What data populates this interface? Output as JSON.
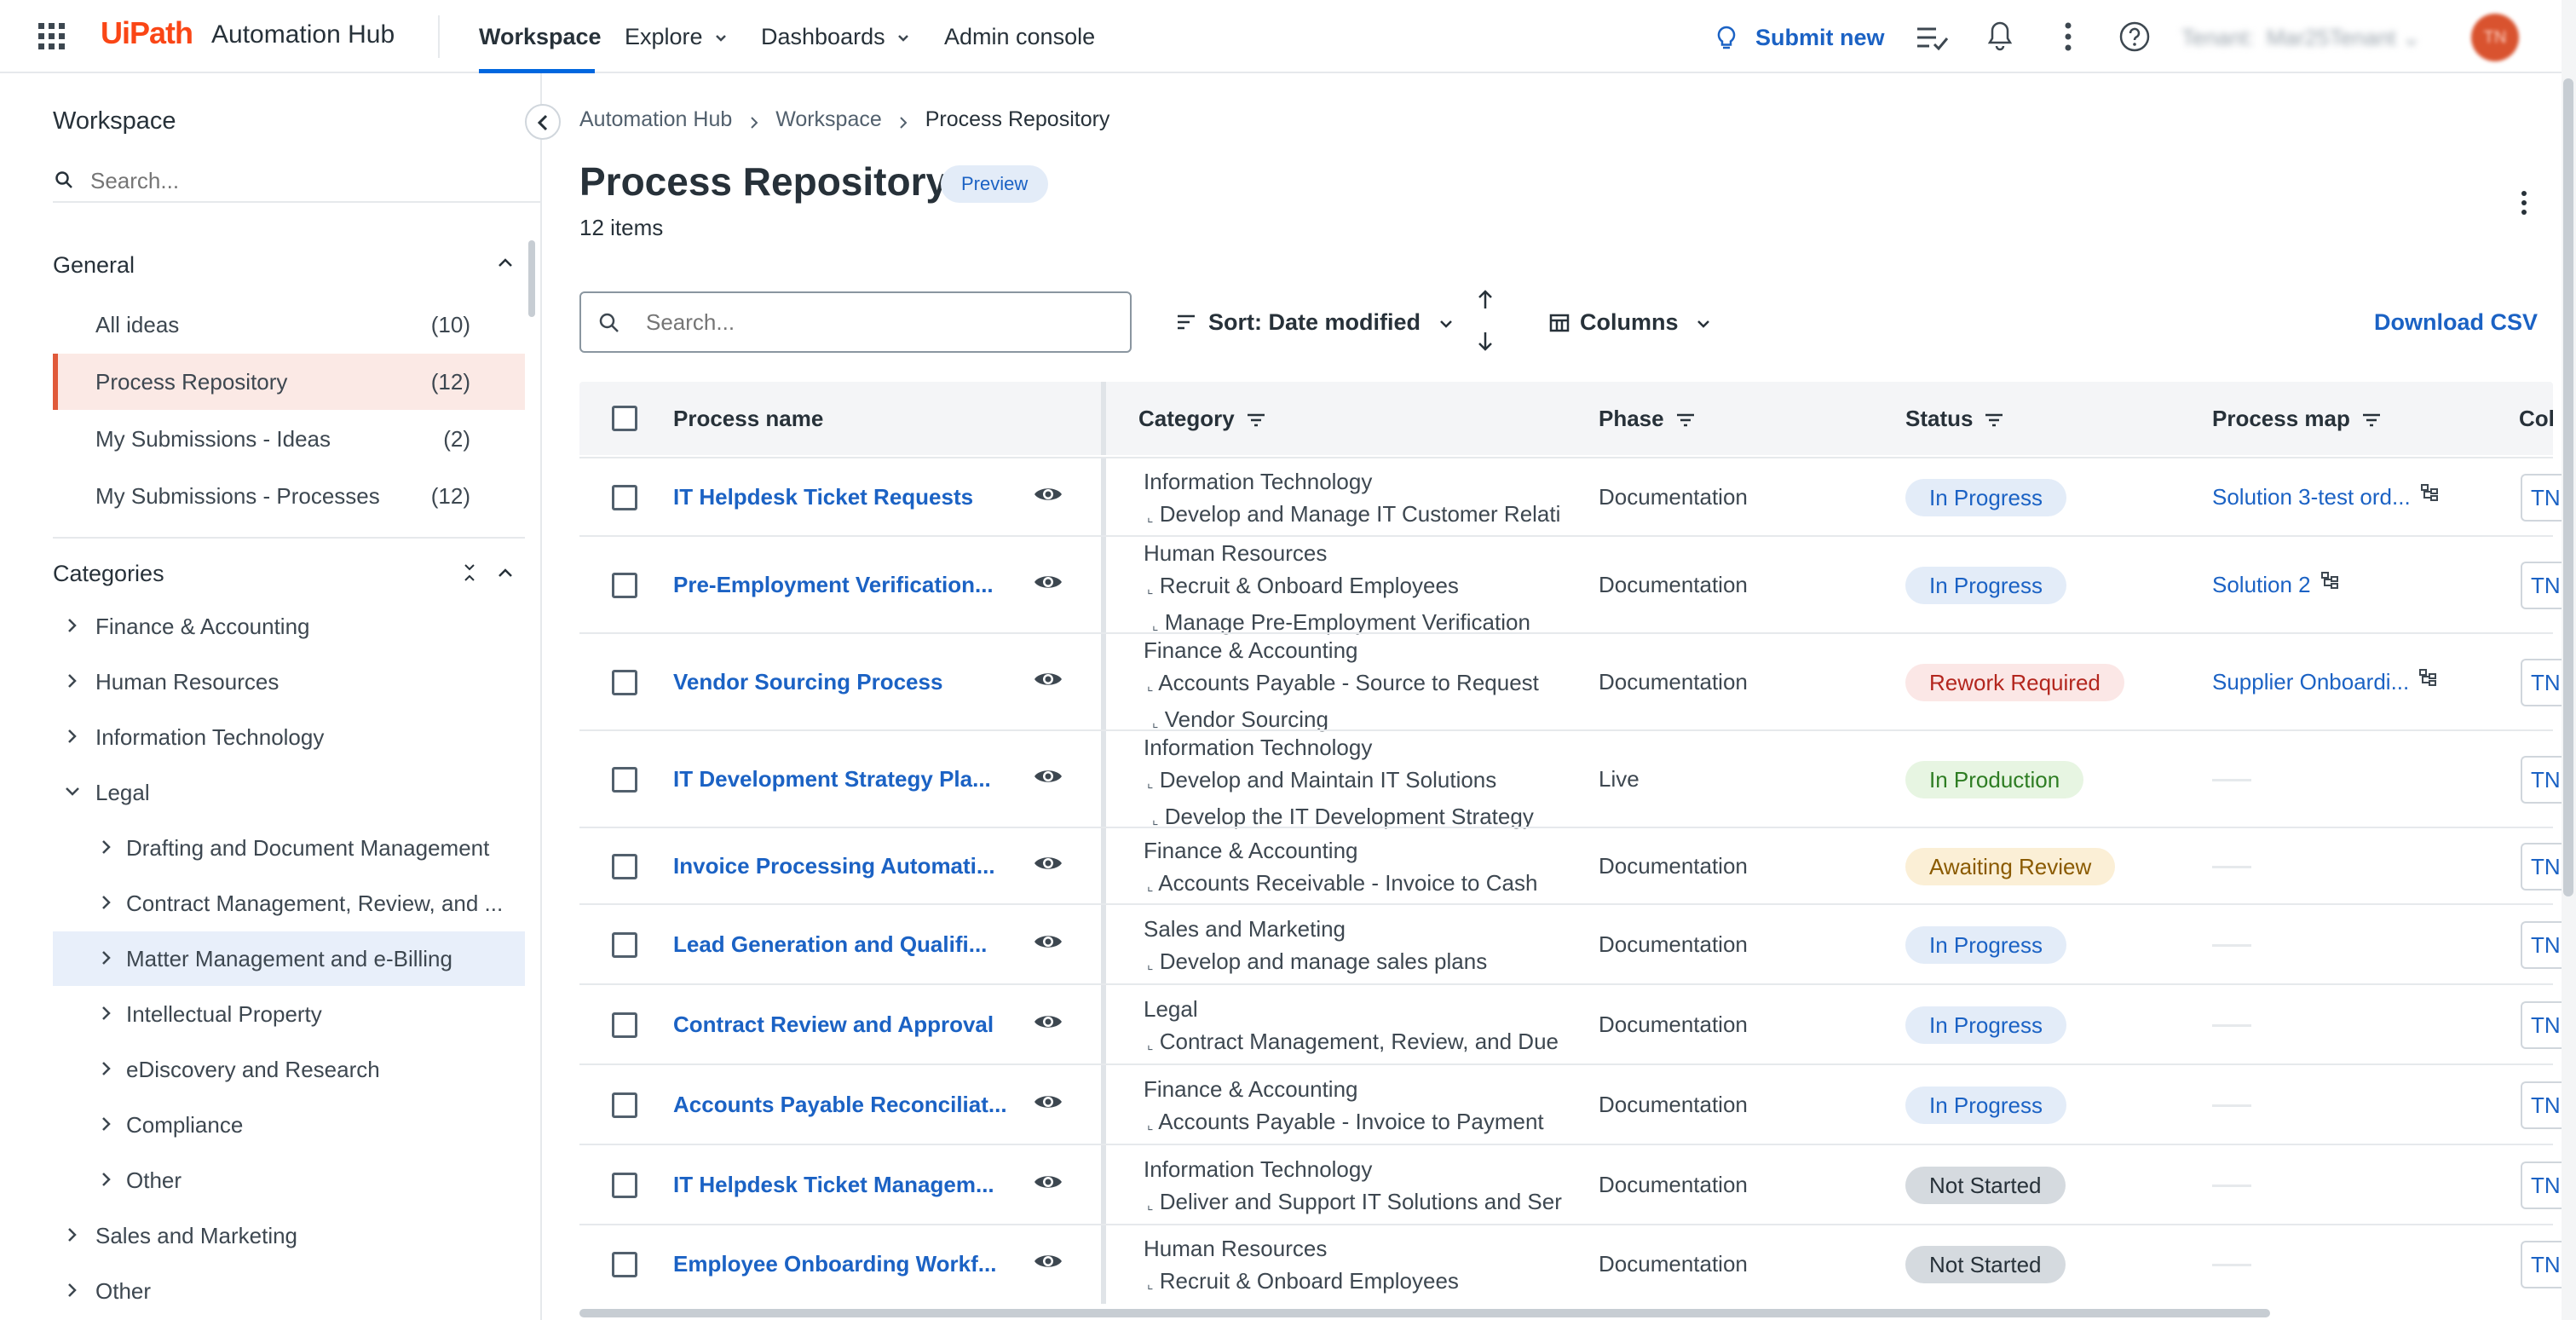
{
  "topbar": {
    "brand_logo": "UiPath",
    "brand_product": "Automation Hub",
    "nav": [
      {
        "label": "Workspace"
      },
      {
        "label": "Explore"
      },
      {
        "label": "Dashboards"
      },
      {
        "label": "Admin console"
      }
    ],
    "submit_label": "Submit new",
    "tenant_label": "Tenant",
    "tenant_value": "Mar25Tenant",
    "avatar_initials": "TN"
  },
  "sidebar": {
    "title": "Workspace",
    "search_placeholder": "Search...",
    "general_label": "General",
    "general_items": [
      {
        "label": "All ideas",
        "count": "(10)"
      },
      {
        "label": "Process Repository",
        "count": "(12)"
      },
      {
        "label": "My Submissions - Ideas",
        "count": "(2)"
      },
      {
        "label": "My Submissions - Processes",
        "count": "(12)"
      }
    ],
    "categories_label": "Categories",
    "categories": [
      {
        "label": "Finance & Accounting"
      },
      {
        "label": "Human Resources"
      },
      {
        "label": "Information Technology"
      },
      {
        "label": "Legal"
      },
      {
        "label": "Drafting and Document Management"
      },
      {
        "label": "Contract Management, Review, and ..."
      },
      {
        "label": "Matter Management and e-Billing"
      },
      {
        "label": "Intellectual Property"
      },
      {
        "label": "eDiscovery and Research"
      },
      {
        "label": "Compliance"
      },
      {
        "label": "Other"
      },
      {
        "label": "Sales and Marketing"
      },
      {
        "label": "Other"
      }
    ]
  },
  "main": {
    "breadcrumb": [
      "Automation Hub",
      "Workspace",
      "Process Repository"
    ],
    "title": "Process Repository",
    "badge": "Preview",
    "item_count": "12 items",
    "search_placeholder": "Search...",
    "sort_label": "Sort: Date modified",
    "columns_label": "Columns",
    "download_label": "Download CSV",
    "table": {
      "headers": [
        "Process name",
        "Category",
        "Phase",
        "Status",
        "Process map",
        "Col"
      ],
      "rows": [
        {
          "name": "IT Helpdesk Ticket Requests",
          "cat": [
            "Information Technology",
            "Develop and Manage IT Customer Relati"
          ],
          "phase": "Documentation",
          "status": "In Progress",
          "map": "Solution 3-test ord...",
          "tn": "TN"
        },
        {
          "name": "Pre-Employment Verification...",
          "cat": [
            "Human Resources",
            "Recruit & Onboard Employees",
            "Manage Pre-Employment Verification"
          ],
          "phase": "Documentation",
          "status": "In Progress",
          "map": "Solution 2",
          "tn": "TN"
        },
        {
          "name": "Vendor Sourcing Process",
          "cat": [
            "Finance & Accounting",
            "Accounts Payable - Source to Request",
            "Vendor Sourcing"
          ],
          "phase": "Documentation",
          "status": "Rework Required",
          "map": "Supplier Onboardi...",
          "tn": "TN"
        },
        {
          "name": "IT Development Strategy Pla...",
          "cat": [
            "Information Technology",
            "Develop and Maintain IT Solutions",
            "Develop the IT Development Strategy"
          ],
          "phase": "Live",
          "status": "In Production",
          "map": "",
          "tn": "TN"
        },
        {
          "name": "Invoice Processing Automati...",
          "cat": [
            "Finance & Accounting",
            "Accounts Receivable  - Invoice to Cash"
          ],
          "phase": "Documentation",
          "status": "Awaiting Review",
          "map": "",
          "tn": "TN"
        },
        {
          "name": "Lead Generation and Qualifi...",
          "cat": [
            "Sales and Marketing",
            "Develop and manage sales plans"
          ],
          "phase": "Documentation",
          "status": "In Progress",
          "map": "",
          "tn": "TN"
        },
        {
          "name": "Contract Review and Approval",
          "cat": [
            "Legal",
            "Contract Management, Review, and Due"
          ],
          "phase": "Documentation",
          "status": "In Progress",
          "map": "",
          "tn": "TN"
        },
        {
          "name": "Accounts Payable Reconciliat...",
          "cat": [
            "Finance & Accounting",
            "Accounts Payable - Invoice to Payment"
          ],
          "phase": "Documentation",
          "status": "In Progress",
          "map": "",
          "tn": "TN"
        },
        {
          "name": "IT Helpdesk Ticket Managem...",
          "cat": [
            "Information Technology",
            "Deliver and Support IT Solutions and Ser"
          ],
          "phase": "Documentation",
          "status": "Not Started",
          "map": "",
          "tn": "TN"
        },
        {
          "name": "Employee Onboarding Workf...",
          "cat": [
            "Human Resources",
            "Recruit & Onboard Employees"
          ],
          "phase": "Documentation",
          "status": "Not Started",
          "map": "",
          "tn": "TN"
        }
      ]
    }
  },
  "colors": {
    "accent": "#0067df",
    "link": "#1b62c4",
    "selected_bg": "#fbe9e5",
    "selected_bar": "#e05a3a",
    "in_progress_bg": "#e3ecf8",
    "rework_bg": "#fbe7e6",
    "production_bg": "#e7f5e2",
    "review_bg": "#fbefd6",
    "not_started_bg": "#d5dadf"
  }
}
